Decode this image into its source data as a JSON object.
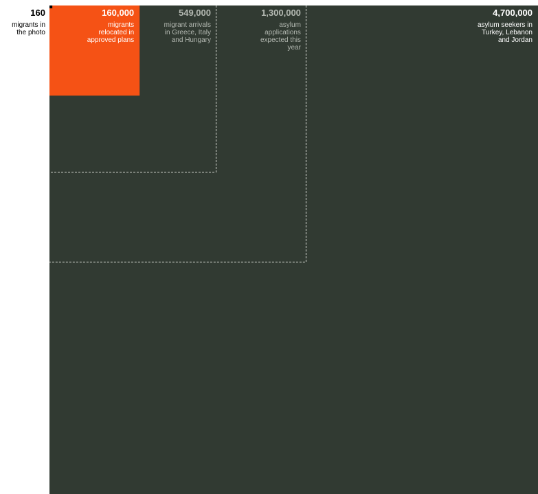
{
  "chart_data": {
    "type": "area",
    "title": "",
    "squares": [
      {
        "value": 4700000,
        "value_label": "4,700,000",
        "description": "asylum seekers in Turkey, Lebanon and Jordan",
        "lines": [
          "asylum seekers in",
          "Turkey, Lebanon",
          "and Jordan"
        ],
        "style": "filled-dark"
      },
      {
        "value": 1300000,
        "value_label": "1,300,000",
        "description": "asylum applications expected this year",
        "lines": [
          "asylum",
          "applications",
          "expected this",
          "year"
        ],
        "style": "outline-dashed"
      },
      {
        "value": 549000,
        "value_label": "549,000",
        "description": "migrant arrivals in Greece, Italy and Hungary",
        "lines": [
          "migrant arrivals",
          "in Greece, Italy",
          "and Hungary"
        ],
        "style": "outline-dashed"
      },
      {
        "value": 160000,
        "value_label": "160,000",
        "description": "migrants relocated in approved plans",
        "lines": [
          "migrants",
          "relocated in",
          "approved plans"
        ],
        "style": "filled-accent"
      },
      {
        "value": 160,
        "value_label": "160",
        "description": "migrants in the photo",
        "lines": [
          "migrants in",
          "the photo"
        ],
        "style": "filled-black"
      }
    ],
    "colors": {
      "dark": "#313a32",
      "accent": "#f55215",
      "tiny": "#000000",
      "dashed": "#d9dcd6",
      "label_on_dark": "#ffffff",
      "label_muted": "#b3b8b1",
      "label_outside": "#000000"
    }
  }
}
